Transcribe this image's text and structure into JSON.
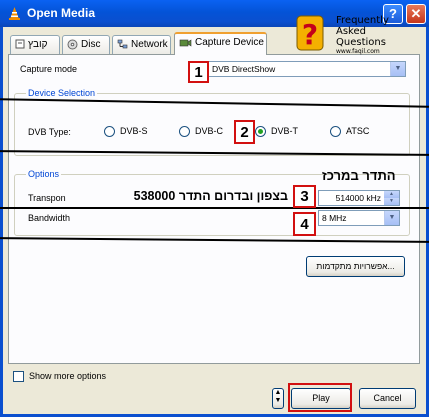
{
  "window": {
    "title": "Open Media",
    "help": "?",
    "close": "✕"
  },
  "tabs": [
    {
      "label": "קובץ",
      "icon": "file-icon"
    },
    {
      "label": "Disc",
      "icon": "disc-icon"
    },
    {
      "label": "Network",
      "icon": "network-icon"
    },
    {
      "label": "Capture Device",
      "icon": "capture-device-icon",
      "active": true
    }
  ],
  "capture_mode": {
    "label": "Capture mode",
    "value": "DVB DirectShow"
  },
  "device_selection": {
    "legend": "Device Selection",
    "dvb_type_label": "DVB Type:",
    "options": [
      "DVB-S",
      "DVB-C",
      "DVB-T",
      "ATSC"
    ],
    "selected": "DVB-T"
  },
  "options_group": {
    "legend": "Options",
    "transponder_label": "Transpon",
    "transponder_value": "514000 kHz",
    "bandwidth_label": "Bandwidth",
    "bandwidth_value": "8 MHz",
    "advanced_button": "אפשרויות מתקדמות..."
  },
  "footer": {
    "show_more": "Show more options",
    "play": "Play",
    "cancel": "Cancel"
  },
  "annotations": {
    "n1": "1",
    "n2": "2",
    "n3": "3",
    "n4": "4",
    "hebrew_center": "התדר במרכז",
    "hebrew_north_south": "בצפון ובדרום התדר 538000"
  },
  "faq_logo": {
    "line1": "Frequently",
    "line2": "Asked",
    "line3": "Questions",
    "url": "www.faqil.com"
  },
  "colors": {
    "titlebar": "#0a4fcf",
    "annotation_red": "#d21010",
    "legend_blue": "#0046d5"
  }
}
